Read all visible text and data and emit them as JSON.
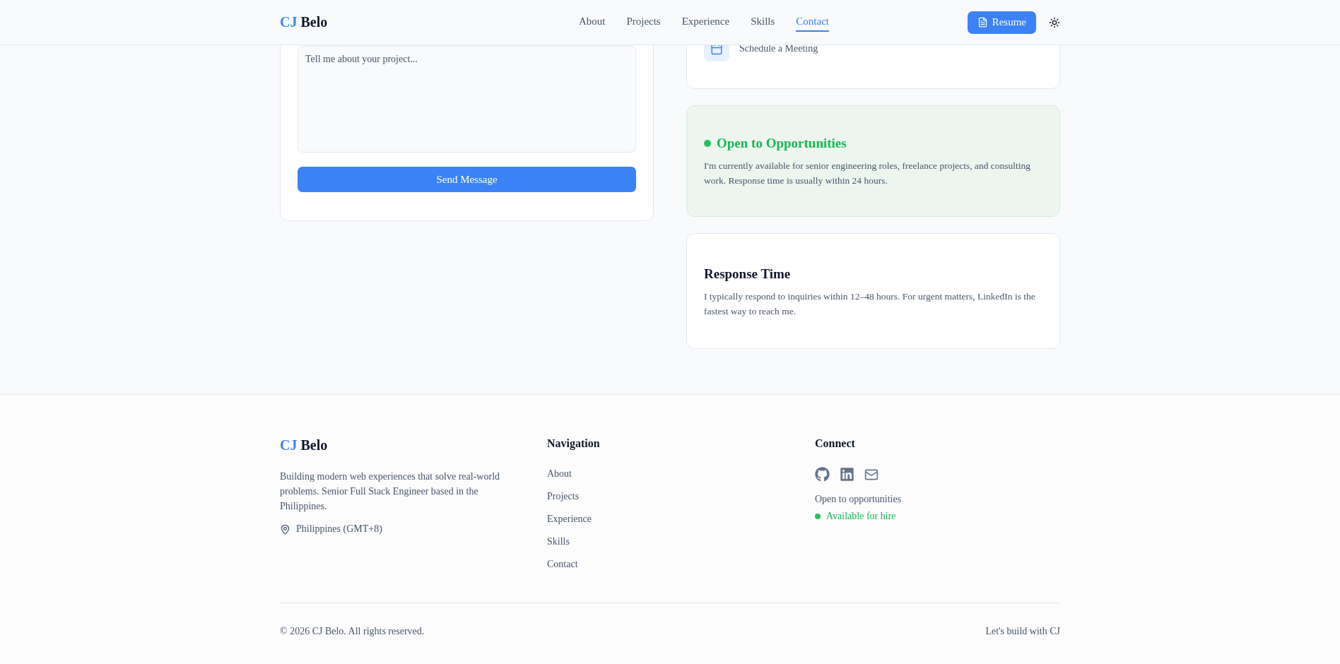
{
  "header": {
    "logo_first": "CJ",
    "logo_last": "Belo",
    "nav": [
      {
        "label": "About",
        "selected": false
      },
      {
        "label": "Projects",
        "selected": false
      },
      {
        "label": "Experience",
        "selected": false
      },
      {
        "label": "Skills",
        "selected": false
      },
      {
        "label": "Contact",
        "selected": true
      }
    ],
    "resume_button": "Resume"
  },
  "contact_form": {
    "message_placeholder": "Tell me about your project...",
    "send_button": "Send Message"
  },
  "contact_info": {
    "items": [
      {
        "text": "Schedule a Meeting"
      }
    ]
  },
  "availability_card": {
    "title": "Open to Opportunities",
    "text": "I'm currently available for senior engineering roles, freelance projects, and consulting work. Response time is usually within 24 hours."
  },
  "response_card": {
    "title": "Response Time",
    "text": "I typically respond to inquiries within 12–48 hours. For urgent matters, LinkedIn is the fastest way to reach me."
  },
  "footer": {
    "logo_first": "CJ",
    "logo_last": "Belo",
    "description": "Building modern web experiences that solve real-world problems. Senior Full Stack Engineer based in the Philippines.",
    "location": "Philippines (GMT+8)",
    "navigation_heading": "Navigation",
    "navigation_links": [
      "About",
      "Projects",
      "Experience",
      "Skills",
      "Contact"
    ],
    "connect_heading": "Connect",
    "status_text": "Open to opportunities",
    "availability": "Available for hire",
    "copyright": "© 2026 CJ Belo. All rights reserved.",
    "tagline": "Let's build with CJ"
  }
}
